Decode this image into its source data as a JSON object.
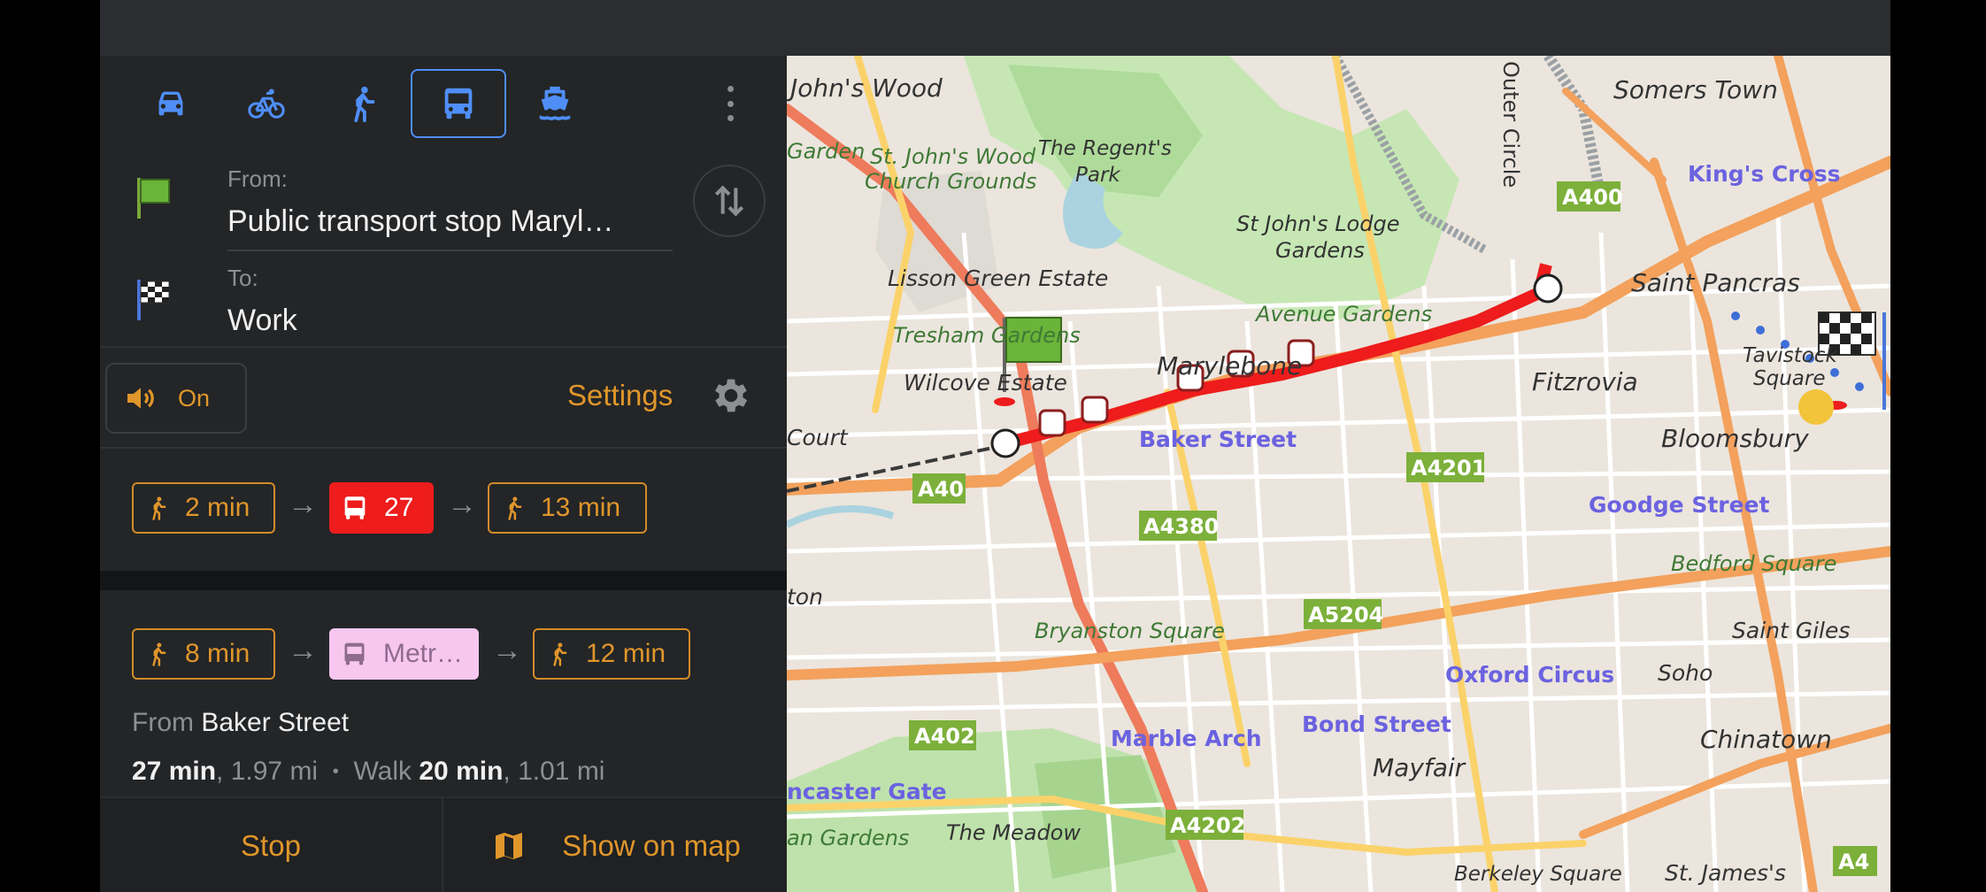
{
  "modes": [
    {
      "name": "car",
      "selected": false
    },
    {
      "name": "bicycle",
      "selected": false
    },
    {
      "name": "walk",
      "selected": false
    },
    {
      "name": "bus",
      "selected": true
    },
    {
      "name": "ferry",
      "selected": false
    }
  ],
  "route": {
    "from_label": "From:",
    "from_value": "Public transport stop Maryl…",
    "to_label": "To:",
    "to_value": "Work"
  },
  "voice": {
    "label": "On"
  },
  "settings_label": "Settings",
  "option1": {
    "walk1": "2 min",
    "bus_number": "27",
    "walk2": "13 min"
  },
  "option2": {
    "walk1": "8 min",
    "metro_label": "Metr…",
    "walk2": "12 min",
    "from_prefix": "From",
    "from_stop": "Baker Street",
    "total_time": "27 min",
    "total_distance": ", 1.97 mi",
    "bullet": "•",
    "walk_prefix": "Walk",
    "walk_time": "20 min",
    "walk_distance": ", 1.01 mi"
  },
  "buttons": {
    "stop": "Stop",
    "show_on_map": "Show on map"
  },
  "colors": {
    "accent": "#e0962b",
    "selected_mode": "#4f8ef7",
    "bus": "#ee1c1c",
    "metro": "#f7c7f0",
    "route_line": "#ee1c1c"
  },
  "map": {
    "labels": {
      "johns_wood": "John's Wood",
      "garden": "Garden",
      "st_johns_wood_church": "St. John's Wood",
      "church_grounds": "Church Grounds",
      "regents_park": "The Regent's",
      "park": "Park",
      "outer_circle": "Outer Circle",
      "somers_town": "Somers Town",
      "kings_cross": "King's Cross",
      "st_johns_lodge": "St John's Lodge",
      "gardens": "Gardens",
      "a400": "A400",
      "lisson_green": "Lisson Green Estate",
      "avenue_gardens": "Avenue Gardens",
      "saint_pancras": "Saint Pancras",
      "tresham_gardens": "Tresham Gardens",
      "marylebone": "Marylebone",
      "tavistock": "Tavistock",
      "square": "Square",
      "wilcove_estate": "Wilcove Estate",
      "fitzrovia": "Fitzrovia",
      "court": "Court",
      "baker_street": "Baker Street",
      "bloomsbury": "Bloomsbury",
      "a40": "A40",
      "a4201": "A4201",
      "a4380": "A4380",
      "goodge_street": "Goodge Street",
      "ton": "ton",
      "bedford_square": "Bedford Square",
      "bryanston_square": "Bryanston Square",
      "a5204": "A5204",
      "saint_giles": "Saint Giles",
      "oxford_circus": "Oxford Circus",
      "soho": "Soho",
      "a402": "A402",
      "marble_arch": "Marble Arch",
      "bond_street": "Bond Street",
      "chinatown": "Chinatown",
      "mayfair": "Mayfair",
      "lancaster_gate": "ncaster Gate",
      "the_meadow": "The Meadow",
      "a4202": "A4202",
      "an_gardens": "an Gardens",
      "berkeley_square": "Berkeley Square",
      "st_james": "St. James's",
      "a4": "A4"
    }
  }
}
